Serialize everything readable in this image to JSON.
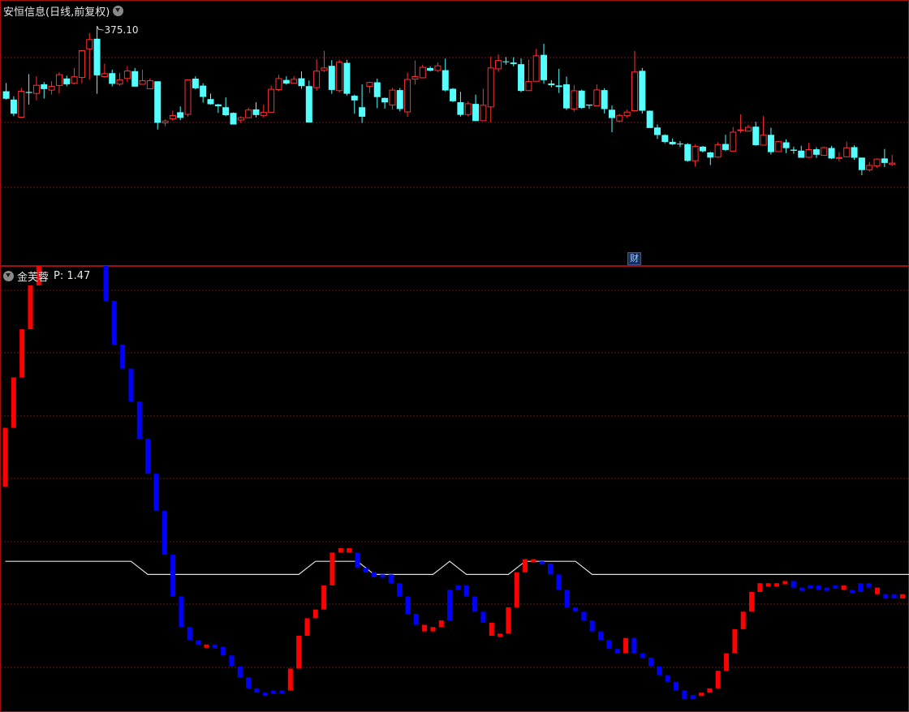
{
  "main_panel": {
    "title": "安恒信息(日线,前复权)",
    "menu_icon": "chevron-down-circle-icon",
    "max_price_label": "375.10",
    "badge": "财"
  },
  "indicator_panel": {
    "title": "金芙蓉",
    "param_label": "P: 1.47",
    "menu_icon": "chevron-down-circle-icon"
  },
  "colors": {
    "background": "#000000",
    "frame": "#a01010",
    "grid": "#6b1414",
    "up": "#ff3030",
    "down": "#54ffff",
    "ind_up": "#ff0000",
    "ind_down": "#0000ff",
    "line": "#e0e0e0"
  },
  "chart_data": [
    {
      "type": "candlestick",
      "series": [
        {
          "name": "安恒信息",
          "values": [
            [
              322.0,
              317.5,
              327.0,
              317.0
            ],
            [
              317.0,
              308.5,
              319.0,
              307.0
            ],
            [
              306.4,
              322.0,
              324.0,
              306.0
            ],
            [
              321.6,
              321.0,
              332.3,
              314.0
            ],
            [
              320.7,
              325.6,
              331.0,
              316.6
            ],
            [
              326.2,
              323.3,
              327.6,
              317.6
            ],
            [
              322.7,
              324.9,
              328.0,
              320.0
            ],
            [
              325.5,
              332.0,
              333.4,
              320.7
            ],
            [
              329.7,
              326.2,
              331.4,
              325.0
            ],
            [
              326.8,
              330.7,
              336.0,
              326.1
            ],
            [
              330.3,
              346.4,
              346.7,
              326.8
            ],
            [
              347.5,
              353.1,
              357.0,
              329.0
            ],
            [
              353.6,
              331.6,
              361.2,
              320.5
            ],
            [
              330.8,
              332.6,
              338.6,
              330.2
            ],
            [
              332.9,
              326.5,
              335.0,
              325.0
            ],
            [
              326.3,
              328.9,
              333.0,
              325.3
            ],
            [
              329.7,
              334.2,
              337.0,
              327.6
            ],
            [
              334.1,
              324.8,
              336.0,
              324.8
            ],
            [
              326.2,
              328.4,
              335.0,
              326.0
            ],
            [
              323.5,
              328.4,
              329.8,
              323.9
            ],
            [
              328.0,
              303.0,
              328.0,
              299.0
            ],
            [
              303.0,
              304.1,
              305.0,
              301.0
            ],
            [
              305.4,
              307.4,
              310.3,
              304.4
            ],
            [
              309.4,
              306.0,
              312.9,
              304.6
            ],
            [
              308.1,
              328.9,
              329.1,
              306.8
            ],
            [
              329.6,
              323.8,
              331.0,
              323.1
            ],
            [
              325.4,
              318.6,
              326.8,
              315.2
            ],
            [
              317.3,
              314.2,
              320.6,
              314.0
            ],
            [
              314.1,
              313.0,
              314.4,
              309.0
            ],
            [
              312.4,
              307.6,
              318.3,
              307.0
            ],
            [
              309.0,
              302.0,
              309.3,
              302.0
            ],
            [
              304.7,
              306.1,
              307.0,
              302.8
            ],
            [
              306.1,
              310.7,
              312.1,
              306.1
            ],
            [
              311.1,
              307.7,
              315.4,
              306.3
            ],
            [
              307.5,
              309.4,
              314.0,
              306.2
            ],
            [
              309.4,
              323.2,
              325.5,
              309.3
            ],
            [
              323.0,
              329.6,
              331.9,
              322.0
            ],
            [
              328.8,
              326.7,
              331.0,
              326.0
            ],
            [
              326.8,
              329.2,
              331.0,
              326.7
            ],
            [
              329.8,
              325.1,
              334.0,
              323.5
            ],
            [
              325.1,
              303.2,
              328.5,
              303.2
            ],
            [
              324.2,
              334.1,
              341.3,
              322.3
            ],
            [
              334.5,
              336.0,
              346.3,
              333.6
            ],
            [
              337.3,
              322.8,
              340.7,
              320.5
            ],
            [
              322.4,
              339.5,
              341.0,
              321.3
            ],
            [
              339.1,
              320.5,
              340.9,
              319.4
            ],
            [
              319.3,
              316.5,
              320.0,
              308.5
            ],
            [
              312.4,
              306.7,
              326.1,
              303.0
            ],
            [
              324.9,
              327.3,
              327.8,
              321.0
            ],
            [
              327.4,
              318.5,
              329.6,
              311.8
            ],
            [
              318.0,
              315.3,
              318.2,
              311.6
            ],
            [
              313.7,
              322.7,
              324.0,
              311.0
            ],
            [
              322.7,
              311.3,
              324.0,
              309.9
            ],
            [
              309.6,
              329.1,
              333.1,
              306.6
            ],
            [
              329.3,
              330.8,
              340.5,
              326.0
            ],
            [
              330.1,
              336.4,
              338.0,
              329.9
            ],
            [
              336.0,
              334.4,
              337.0,
              334.0
            ],
            [
              334.5,
              337.3,
              339.4,
              333.6
            ],
            [
              334.7,
              322.5,
              341.6,
              321.9
            ],
            [
              323.5,
              316.0,
              324.0,
              315.5
            ],
            [
              315.4,
              307.8,
              321.7,
              306.8
            ],
            [
              308.0,
              314.5,
              315.8,
              307.0
            ],
            [
              314.4,
              304.1,
              320.0,
              304.0
            ],
            [
              304.3,
              313.6,
              323.6,
              305.1
            ],
            [
              312.6,
              336.0,
              342.8,
              303.3
            ],
            [
              335.5,
              340.5,
              344.2,
              333.7
            ],
            [
              340.0,
              339.7,
              342.6,
              338.0
            ],
            [
              339.3,
              338.4,
              342.5,
              337.0
            ],
            [
              338.3,
              322.2,
              341.7,
              321.5
            ],
            [
              322.4,
              327.8,
              341.1,
              326.8
            ],
            [
              328.0,
              343.3,
              347.5,
              328.2
            ],
            [
              343.9,
              328.7,
              350.6,
              326.5
            ],
            [
              326.7,
              325.7,
              328.7,
              324.4
            ],
            [
              325.5,
              324.6,
              335.5,
              321.0
            ],
            [
              326.2,
              311.7,
              330.8,
              310.7
            ],
            [
              311.4,
              322.3,
              325.8,
              309.8
            ],
            [
              322.4,
              312.0,
              323.0,
              311.4
            ],
            [
              314.0,
              313.4,
              314.0,
              311.4
            ],
            [
              313.3,
              322.8,
              326.1,
              312.9
            ],
            [
              322.7,
              311.3,
              323.9,
              308.7
            ],
            [
              310.9,
              305.9,
              313.4,
              297.4
            ],
            [
              304.1,
              307.5,
              308.3,
              303.4
            ],
            [
              307.3,
              309.5,
              311.0,
              306.0
            ],
            [
              310.3,
              333.6,
              346.3,
              309.7
            ],
            [
              334.3,
              310.3,
              336.0,
              308.6
            ],
            [
              310.3,
              299.9,
              310.4,
              300.0
            ],
            [
              300.2,
              295.7,
              302.1,
              293.3
            ],
            [
              295.7,
              291.5,
              296.1,
              290.7
            ],
            [
              291.6,
              290.1,
              293.6,
              289.7
            ],
            [
              290.5,
              290.2,
              292.0,
              288.4
            ],
            [
              290.2,
              280.1,
              290.8,
              279.6
            ],
            [
              280.2,
              288.8,
              290.0,
              276.7
            ],
            [
              288.7,
              285.9,
              289.1,
              285.2
            ],
            [
              285.2,
              282.1,
              285.6,
              277.6
            ],
            [
              282.4,
              289.9,
              291.4,
              282.0
            ],
            [
              290.3,
              286.7,
              295.8,
              286.0
            ],
            [
              286.0,
              297.4,
              300.5,
              286.0
            ],
            [
              298.6,
              298.8,
              308.1,
              296.9
            ],
            [
              298.0,
              300.3,
              301.8,
              298.0
            ],
            [
              300.7,
              289.6,
              303.6,
              289.3
            ],
            [
              289.6,
              295.6,
              307.1,
              289.9
            ],
            [
              295.8,
              285.4,
              300.1,
              284.0
            ],
            [
              285.7,
              291.7,
              292.1,
              285.7
            ],
            [
              291.3,
              287.8,
              293.1,
              284.8
            ],
            [
              286.9,
              286.2,
              288.7,
              284.4
            ],
            [
              286.3,
              282.0,
              289.2,
              282.0
            ],
            [
              282.3,
              286.9,
              290.9,
              281.9
            ],
            [
              287.1,
              283.8,
              288.3,
              281.9
            ],
            [
              283.5,
              288.1,
              288.7,
              283.9
            ],
            [
              287.9,
              281.6,
              289.1,
              281.2
            ],
            [
              282.0,
              282.1,
              285.4,
              279.7
            ],
            [
              282.6,
              288.0,
              291.7,
              282.5
            ],
            [
              288.4,
              282.0,
              289.5,
              280.8
            ],
            [
              282.1,
              274.6,
              282.1,
              271.5
            ],
            [
              274.8,
              277.4,
              279.5,
              273.6
            ],
            [
              277.1,
              281.2,
              281.6,
              276.0
            ],
            [
              281.6,
              278.9,
              287.3,
              276.4
            ],
            [
              278.0,
              278.8,
              283.7,
              277.0
            ]
          ]
        }
      ]
    },
    {
      "type": "bar",
      "series": [
        {
          "name": "level",
          "values": [
            1.25,
            1.48,
            1.7,
            1.9,
            2.03,
            2.1,
            2.06,
            2.06,
            2.05,
            2.04,
            2.05,
            2.07,
            1.83,
            1.63,
            1.52,
            1.37,
            1.2,
            1.04,
            0.87,
            0.67,
            0.48,
            0.34,
            0.28,
            0.26,
            0.26,
            0.25,
            0.21,
            0.16,
            0.11,
            0.06,
            0.04,
            0.04,
            0.05,
            0.05,
            0.15,
            0.3,
            0.38,
            0.42,
            0.53,
            0.68,
            0.7,
            0.68,
            0.61,
            0.59,
            0.57,
            0.58,
            0.54,
            0.48,
            0.4,
            0.35,
            0.32,
            0.34,
            0.37,
            0.51,
            0.53,
            0.48,
            0.41,
            0.36,
            0.3,
            0.31,
            0.43,
            0.59,
            0.65,
            0.64,
            0.63,
            0.58,
            0.51,
            0.43,
            0.41,
            0.37,
            0.32,
            0.28,
            0.24,
            0.22,
            0.29,
            0.22,
            0.2,
            0.16,
            0.12,
            0.09,
            0.05,
            0.01,
            0.03,
            0.04,
            0.06,
            0.14,
            0.22,
            0.33,
            0.41,
            0.5,
            0.54,
            0.54,
            0.54,
            0.55,
            0.52,
            0.52,
            0.53,
            0.51,
            0.52,
            0.53,
            0.51,
            0.5,
            0.54,
            0.52,
            0.49,
            0.47,
            0.49,
            0.47
          ]
        },
        {
          "name": "direction",
          "values": [
            1,
            1,
            1,
            1,
            1,
            1,
            -1,
            1,
            -1,
            1,
            1,
            1,
            -1,
            -1,
            -1,
            -1,
            -1,
            -1,
            -1,
            -1,
            -1,
            -1,
            -1,
            -1,
            1,
            -1,
            -1,
            -1,
            -1,
            -1,
            -1,
            -1,
            -1,
            -1,
            1,
            1,
            1,
            1,
            1,
            1,
            1,
            1,
            -1,
            -1,
            -1,
            -1,
            -1,
            -1,
            -1,
            -1,
            1,
            1,
            1,
            -1,
            -1,
            -1,
            -1,
            -1,
            1,
            1,
            1,
            1,
            1,
            1,
            -1,
            -1,
            -1,
            -1,
            -1,
            -1,
            -1,
            -1,
            -1,
            -1,
            1,
            -1,
            -1,
            -1,
            -1,
            -1,
            -1,
            -1,
            -1,
            1,
            1,
            1,
            1,
            1,
            1,
            1,
            1,
            1,
            1,
            1,
            -1,
            -1,
            -1,
            -1,
            -1,
            -1,
            1,
            -1,
            -1,
            -1,
            1,
            -1,
            -1,
            1
          ]
        },
        {
          "name": "white_line",
          "values": [
            0.64,
            0.64,
            0.64,
            0.64,
            0.64,
            0.64,
            0.64,
            0.64,
            0.64,
            0.64,
            0.64,
            0.64,
            0.64,
            0.64,
            0.64,
            0.64,
            0.61,
            0.58,
            0.58,
            0.58,
            0.58,
            0.58,
            0.58,
            0.58,
            0.58,
            0.58,
            0.58,
            0.58,
            0.58,
            0.58,
            0.58,
            0.58,
            0.58,
            0.58,
            0.58,
            0.58,
            0.61,
            0.64,
            0.64,
            0.64,
            0.64,
            0.64,
            0.64,
            0.61,
            0.58,
            0.58,
            0.58,
            0.58,
            0.58,
            0.58,
            0.58,
            0.58,
            0.61,
            0.64,
            0.61,
            0.58,
            0.58,
            0.58,
            0.58,
            0.58,
            0.58,
            0.61,
            0.64,
            0.64,
            0.64,
            0.64,
            0.64,
            0.64,
            0.64,
            0.61,
            0.58,
            0.58,
            0.58,
            0.58,
            0.58,
            0.58,
            0.58,
            0.58,
            0.58,
            0.58,
            0.58,
            0.58,
            0.58,
            0.58,
            0.58,
            0.58,
            0.58,
            0.58,
            0.58,
            0.58,
            0.58,
            0.58,
            0.58,
            0.58,
            0.58,
            0.58,
            0.58,
            0.58,
            0.58,
            0.58,
            0.58,
            0.58,
            0.58,
            0.58,
            0.58,
            0.58,
            0.58,
            0.58,
            0.58,
            0.58,
            0.58,
            0.58
          ]
        }
      ]
    }
  ]
}
